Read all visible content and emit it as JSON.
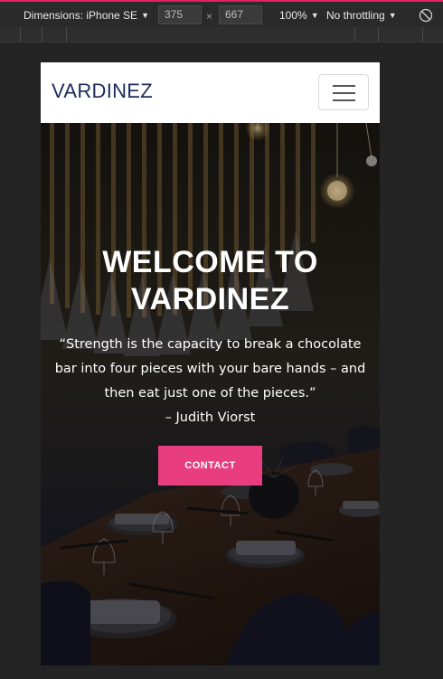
{
  "devtools": {
    "dimensions_label": "Dimensions: iPhone SE",
    "width_value": "375",
    "height_value": "667",
    "times": "×",
    "zoom_label": "100%",
    "throttle_label": "No throttling",
    "accent_color": "#e91e63"
  },
  "navbar": {
    "brand": "VARDINEZ",
    "brand_color": "#1d2a5a",
    "menu_icon": "hamburger-icon"
  },
  "hero": {
    "title_line1": "WELCOME TO",
    "title_line2": "VARDINEZ",
    "quote": "“Strength is the capacity to break a chocolate bar into four pieces with your bare hands – and then eat just one of the pieces.”",
    "author": "– Judith Viorst",
    "contact_label": "CONTACT",
    "contact_color": "#e83e7f"
  }
}
